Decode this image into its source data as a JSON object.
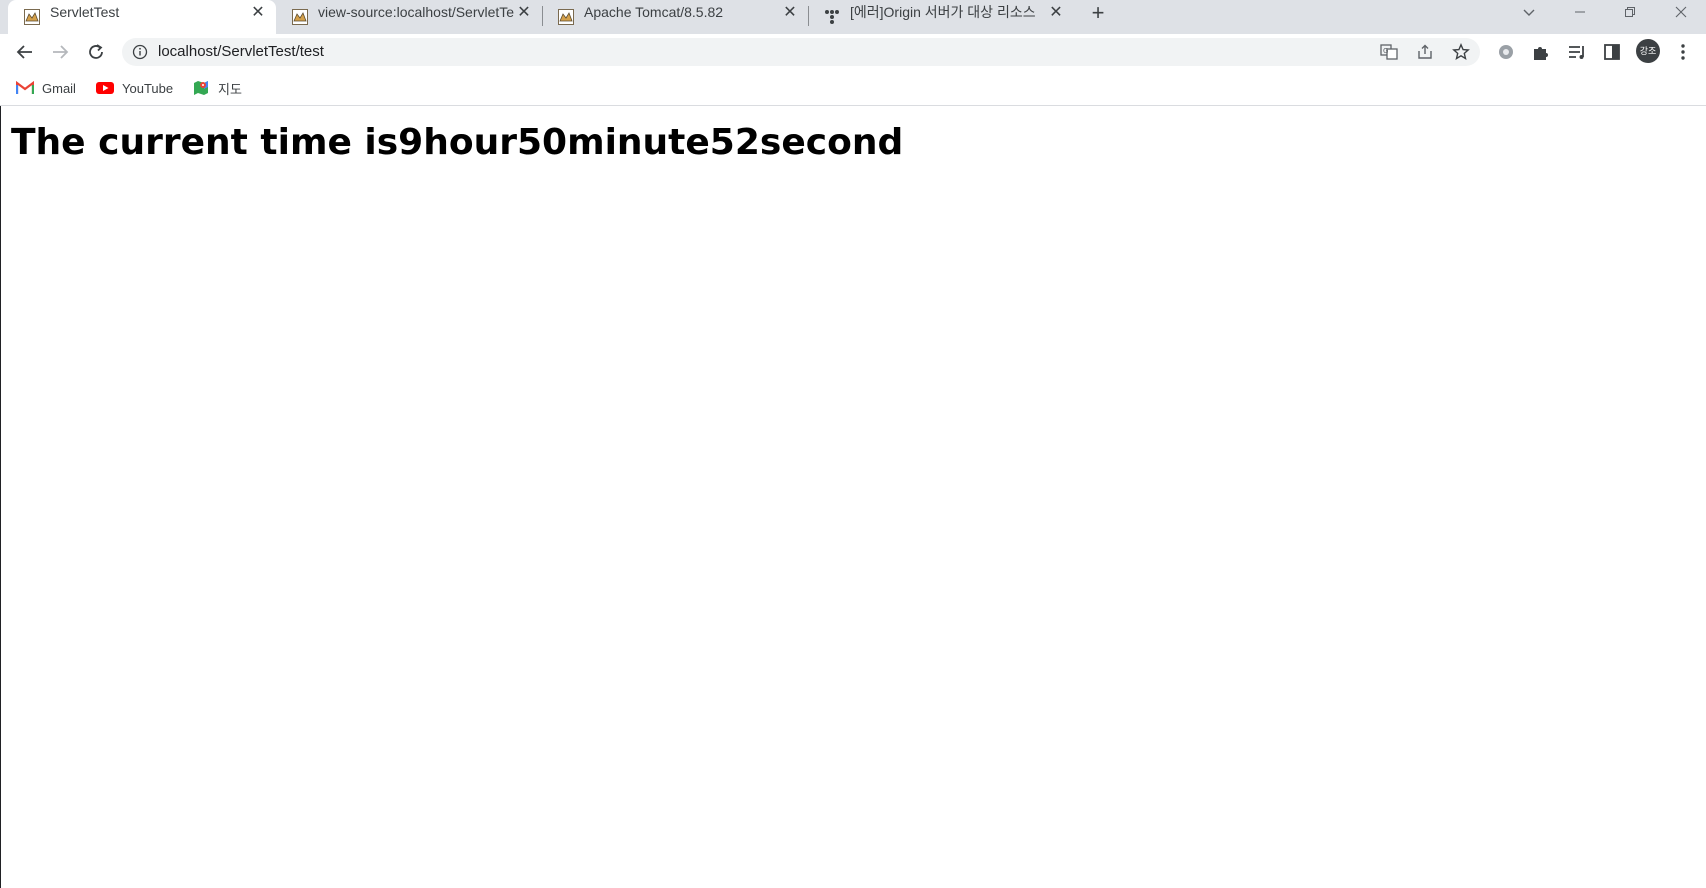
{
  "tabs": [
    {
      "title": "ServletTest",
      "active": true,
      "favicon": "tomcat-icon"
    },
    {
      "title": "view-source:localhost/ServletTes",
      "active": false,
      "favicon": "tomcat-icon"
    },
    {
      "title": "Apache Tomcat/8.5.82",
      "active": false,
      "favicon": "tomcat-icon"
    },
    {
      "title": "[에러]Origin 서버가 대상 리소스",
      "active": false,
      "favicon": "tistory-icon"
    }
  ],
  "address_bar": {
    "url": "localhost/ServletTest/test"
  },
  "bookmarks": [
    {
      "label": "Gmail",
      "icon": "gmail-icon"
    },
    {
      "label": "YouTube",
      "icon": "youtube-icon"
    },
    {
      "label": "지도",
      "icon": "maps-icon"
    }
  ],
  "profile": {
    "initials": "강조"
  },
  "page": {
    "heading": "The current time is9hour50minute52second"
  },
  "colors": {
    "tabstrip": "#dee1e6",
    "omnibox": "#f1f3f4",
    "text": "#202124"
  }
}
